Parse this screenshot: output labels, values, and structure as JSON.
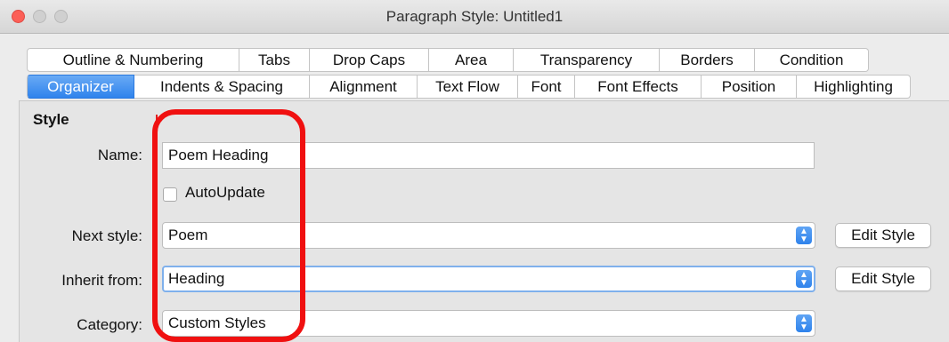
{
  "window": {
    "title": "Paragraph Style: Untitled1"
  },
  "tabs": {
    "row1": [
      "Outline & Numbering",
      "Tabs",
      "Drop Caps",
      "Area",
      "Transparency",
      "Borders",
      "Condition"
    ],
    "row2": [
      "Organizer",
      "Indents & Spacing",
      "Alignment",
      "Text Flow",
      "Font",
      "Font Effects",
      "Position",
      "Highlighting"
    ],
    "active": "Organizer"
  },
  "style": {
    "section_label": "Style",
    "name_label": "Name:",
    "name_value": "Poem Heading",
    "autoupdate_label": "AutoUpdate",
    "autoupdate_checked": false,
    "next_style_label": "Next style:",
    "next_style_value": "Poem",
    "inherit_label": "Inherit from:",
    "inherit_value": "Heading",
    "category_label": "Category:",
    "category_value": "Custom Styles",
    "edit_style_label": "Edit Style"
  },
  "colors": {
    "accent": "#2f83ec",
    "highlight": "#f01010"
  }
}
